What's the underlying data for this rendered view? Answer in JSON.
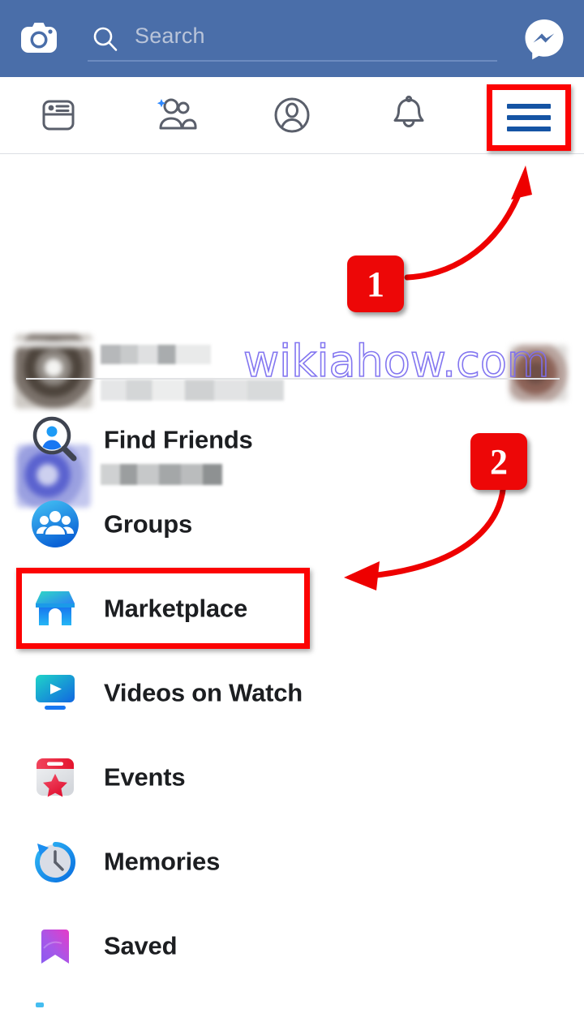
{
  "app": {
    "name": "Facebook",
    "screen": "Menu",
    "brand_color": "#4a6ea9",
    "highlight_color": "#fc0303",
    "accent_blue": "#1554a4"
  },
  "topbar": {
    "camera_icon": "camera-icon",
    "search": {
      "placeholder": "Search",
      "value": "",
      "icon": "search-icon"
    },
    "messenger_icon": "messenger-icon"
  },
  "tabs": [
    {
      "name": "news-feed",
      "icon": "news-feed-icon",
      "active": false
    },
    {
      "name": "friends",
      "icon": "friend-requests-icon",
      "active": false
    },
    {
      "name": "profile",
      "icon": "profile-circle-icon",
      "active": false
    },
    {
      "name": "notifications",
      "icon": "bell-icon",
      "active": false
    },
    {
      "name": "menu",
      "icon": "hamburger-menu-icon",
      "active": true
    }
  ],
  "profile_section": {
    "rows": [
      {
        "name": "user-profile-row",
        "avatar": "blurred-avatar",
        "primary_text": "",
        "secondary_text": "",
        "blurred": true
      },
      {
        "name": "page-profile-row",
        "avatar": "blurred-avatar",
        "primary_text": "",
        "blurred": true
      }
    ],
    "edge_avatar": {
      "name": "blurred-avatar-edge",
      "blurred": true
    }
  },
  "watermark": {
    "text": "wikiahow.com",
    "color": "#7d6ff0"
  },
  "menu": {
    "items": [
      {
        "label": "Find Friends",
        "icon": "find-friends-icon",
        "highlighted": false
      },
      {
        "label": "Groups",
        "icon": "groups-icon",
        "highlighted": false
      },
      {
        "label": "Marketplace",
        "icon": "marketplace-icon",
        "highlighted": true
      },
      {
        "label": "Videos on Watch",
        "icon": "watch-video-icon",
        "highlighted": false
      },
      {
        "label": "Events",
        "icon": "events-calendar-icon",
        "highlighted": false
      },
      {
        "label": "Memories",
        "icon": "memories-clock-icon",
        "highlighted": false
      },
      {
        "label": "Saved",
        "icon": "saved-bookmark-icon",
        "highlighted": false
      }
    ]
  },
  "callouts": [
    {
      "number": "1",
      "target": "hamburger-menu-icon",
      "arrow": "curved-arrow-up-right"
    },
    {
      "number": "2",
      "target": "marketplace-menu-item",
      "arrow": "curved-arrow-down-left"
    }
  ]
}
